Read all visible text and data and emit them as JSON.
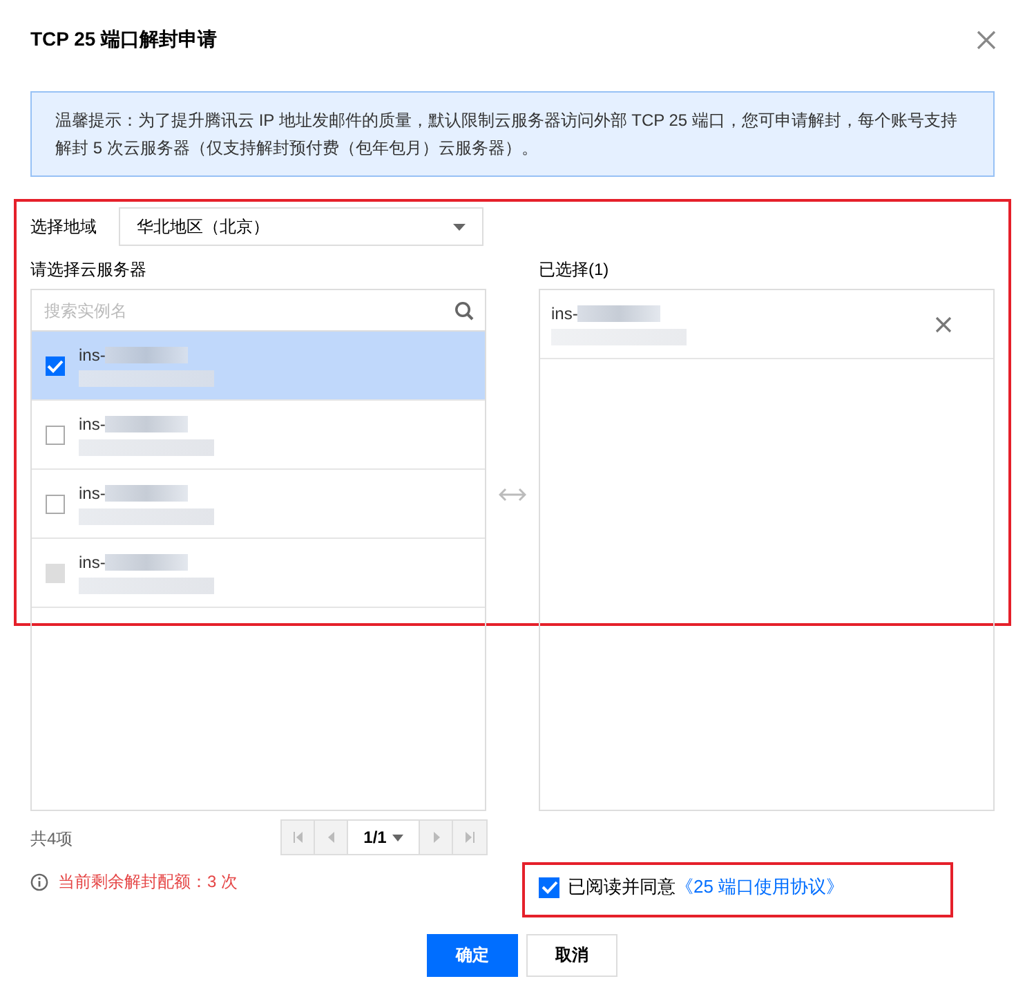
{
  "dialog": {
    "title": "TCP 25 端口解封申请",
    "notice": "温馨提示：为了提升腾讯云 IP 地址发邮件的质量，默认限制云服务器访问外部 TCP 25 端口，您可申请解封，每个账号支持解封 5 次云服务器（仅支持解封预付费（包年包月）云服务器）。",
    "region": {
      "label": "选择地域",
      "value": "华北地区（北京）"
    },
    "source": {
      "label": "请选择云服务器",
      "search_placeholder": "搜索实例名",
      "items": [
        {
          "name": "ins-",
          "checked": true,
          "disabled": false,
          "selected": true
        },
        {
          "name": "ins-",
          "checked": false,
          "disabled": false,
          "selected": false
        },
        {
          "name": "ins-",
          "checked": false,
          "disabled": false,
          "selected": false
        },
        {
          "name": "ins-",
          "checked": false,
          "disabled": true,
          "selected": false
        }
      ],
      "total": "共4项",
      "pager": "1/1"
    },
    "target": {
      "label": "已选择(1)",
      "items": [
        {
          "name": "ins-"
        }
      ]
    },
    "quota": "当前剩余解封配额：3 次",
    "agreement": {
      "checked": true,
      "text": "已阅读并同意",
      "link": "《25 端口使用协议》"
    },
    "buttons": [
      {
        "label": "确定",
        "kind": "primary"
      },
      {
        "label": "取消",
        "kind": "secondary"
      }
    ]
  }
}
